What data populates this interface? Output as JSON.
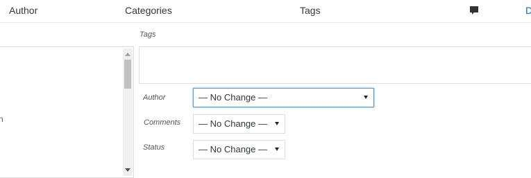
{
  "columns": {
    "author": "Author",
    "categories": "Categories",
    "tags": "Tags",
    "comments_icon": "comment-bubble-icon",
    "date_partial": "D"
  },
  "inline_edit": {
    "categories_partial_text": "n",
    "tags_label": "Tags",
    "tags_value": "",
    "author_label": "Author",
    "author_selected": "— No Change —",
    "comments_label": "Comments",
    "comments_selected": "— No Change —",
    "status_label": "Status",
    "status_selected": "— No Change —"
  },
  "colors": {
    "link": "#0073aa",
    "focus_border": "#5b9dd9",
    "text": "#32373c"
  }
}
